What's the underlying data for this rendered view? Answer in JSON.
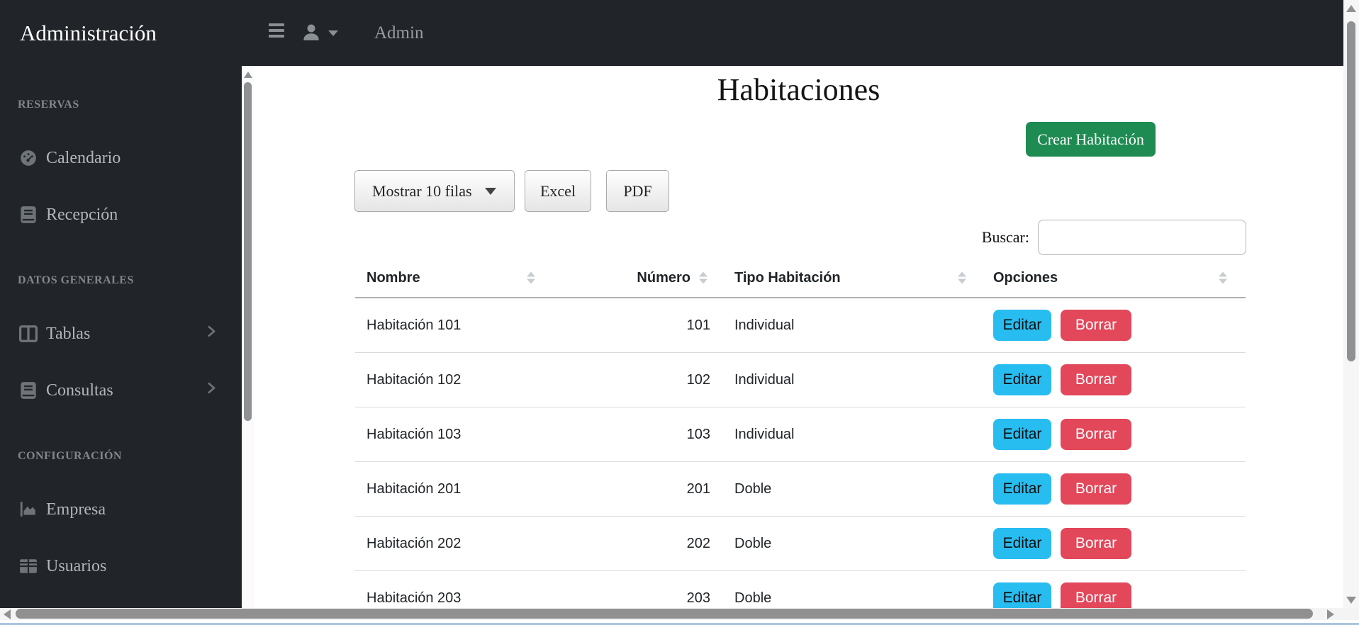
{
  "brand": "Administración",
  "navbar": {
    "user_label": "Admin"
  },
  "sidebar": {
    "sections": [
      {
        "label": "RESERVAS",
        "items": [
          {
            "label": "Calendario",
            "icon": "tachometer-icon",
            "has_submenu": false
          },
          {
            "label": "Recepción",
            "icon": "book-icon",
            "has_submenu": false
          }
        ]
      },
      {
        "label": "DATOS GENERALES",
        "items": [
          {
            "label": "Tablas",
            "icon": "table-columns-icon",
            "has_submenu": true
          },
          {
            "label": "Consultas",
            "icon": "book-icon",
            "has_submenu": true
          }
        ]
      },
      {
        "label": "CONFIGURACIÓN",
        "items": [
          {
            "label": "Empresa",
            "icon": "chart-area-icon",
            "has_submenu": false
          },
          {
            "label": "Usuarios",
            "icon": "table-cells-icon",
            "has_submenu": false
          }
        ]
      }
    ]
  },
  "main": {
    "title": "Habitaciones",
    "create_button_label": "Crear Habitación",
    "toolbar": {
      "length_label": "Mostrar 10 filas",
      "excel_label": "Excel",
      "pdf_label": "PDF"
    },
    "search_label": "Buscar:",
    "search_value": "",
    "table": {
      "columns": [
        "Nombre",
        "Número",
        "Tipo Habitación",
        "Opciones"
      ],
      "rows": [
        {
          "nombre": "Habitación 101",
          "numero": "101",
          "tipo": "Individual"
        },
        {
          "nombre": "Habitación 102",
          "numero": "102",
          "tipo": "Individual"
        },
        {
          "nombre": "Habitación 103",
          "numero": "103",
          "tipo": "Individual"
        },
        {
          "nombre": "Habitación 201",
          "numero": "201",
          "tipo": "Doble"
        },
        {
          "nombre": "Habitación 202",
          "numero": "202",
          "tipo": "Doble"
        },
        {
          "nombre": "Habitación 203",
          "numero": "203",
          "tipo": "Doble"
        }
      ],
      "actions": {
        "edit_label": "Editar",
        "delete_label": "Borrar"
      }
    }
  },
  "colors": {
    "chrome_bg": "#212529",
    "success_green": "#1e8c52",
    "edit_cyan": "#27bdf0",
    "delete_red": "#e2475a",
    "sidebar_text": "#b2b6ba",
    "scrollbar_thumb": "#8f9193",
    "window_edge_blue": "#a7c5e2"
  }
}
